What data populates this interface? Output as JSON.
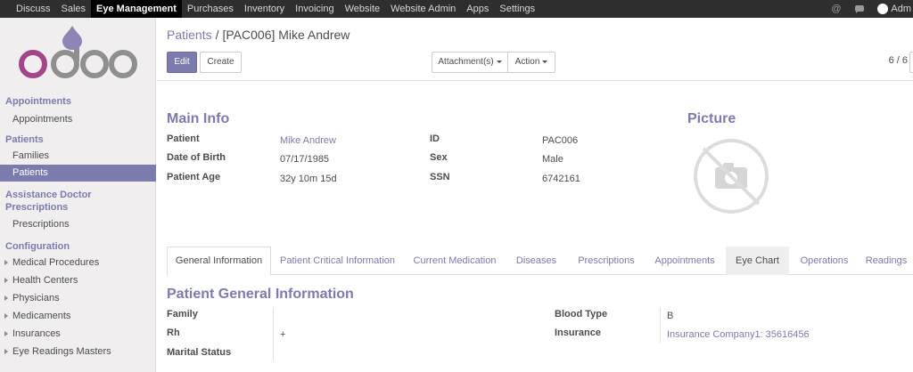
{
  "topbar": {
    "menu": [
      "Discuss",
      "Sales",
      "Eye Management",
      "Purchases",
      "Inventory",
      "Invoicing",
      "Website",
      "Website Admin",
      "Apps",
      "Settings"
    ],
    "active_index": 2,
    "user_name": "Adm"
  },
  "sidebar": {
    "appointments": {
      "heading": "Appointments",
      "items": [
        "Appointments"
      ]
    },
    "patients": {
      "heading": "Patients",
      "items": [
        "Families",
        "Patients"
      ]
    },
    "assistance": {
      "heading_line1": "Assistance Doctor",
      "heading_line2": "Prescriptions",
      "items": [
        "Prescriptions"
      ]
    },
    "configuration": {
      "heading": "Configuration",
      "items": [
        "Medical Procedures",
        "Health Centers",
        "Physicians",
        "Medicaments",
        "Insurances",
        "Eye Readings Masters"
      ]
    }
  },
  "control_panel": {
    "breadcrumb_parent": "Patients",
    "breadcrumb_sep": "/",
    "breadcrumb_current": "[PAC006] Mike Andrew",
    "edit_label": "Edit",
    "create_label": "Create",
    "attachments_label": "Attachment(s)",
    "action_label": "Action",
    "pager": "6 / 6"
  },
  "main_info": {
    "title": "Main Info",
    "picture_title": "Picture",
    "patient_label": "Patient",
    "patient_value": "Mike Andrew",
    "dob_label": "Date of Birth",
    "dob_value": "07/17/1985",
    "age_label": "Patient Age",
    "age_value": "32y 10m 15d",
    "id_label": "ID",
    "id_value": "PAC006",
    "sex_label": "Sex",
    "sex_value": "Male",
    "ssn_label": "SSN",
    "ssn_value": "6742161"
  },
  "tabs": [
    "General Information",
    "Patient Critical Information",
    "Current Medication",
    "Diseases",
    "Prescriptions",
    "Appointments",
    "Eye Chart",
    "Operations",
    "Readings"
  ],
  "general_info": {
    "title": "Patient General Information",
    "family_label": "Family",
    "family_value": "",
    "rh_label": "Rh",
    "rh_value": "+",
    "marital_label": "Marital Status",
    "marital_value": "",
    "blood_label": "Blood Type",
    "blood_value": "B",
    "insurance_label": "Insurance",
    "insurance_value": "Insurance Company1: 35616456"
  },
  "colors": {
    "accent": "#7c7bad",
    "topbar": "#2e2e2e",
    "sidebar": "#f0eeee"
  },
  "icons": [
    "odoo-logo",
    "at-icon",
    "chat-icon",
    "user-avatar",
    "caret-right-icon",
    "caret-down-icon",
    "no-photo-icon"
  ]
}
